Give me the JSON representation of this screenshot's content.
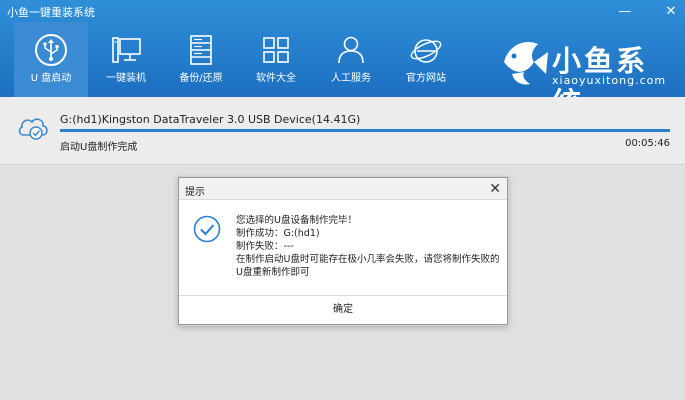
{
  "window": {
    "title": "小鱼一键重装系统",
    "minimize": "—",
    "close": "✕"
  },
  "nav": [
    {
      "id": "usb",
      "label": "U 盘启动",
      "icon": "usb-icon",
      "active": true
    },
    {
      "id": "reinstall",
      "label": "一键装机",
      "icon": "computer-icon"
    },
    {
      "id": "backup",
      "label": "备份/还原",
      "icon": "server-icon"
    },
    {
      "id": "software",
      "label": "软件大全",
      "icon": "grid-icon"
    },
    {
      "id": "service",
      "label": "人工服务",
      "icon": "person-icon"
    },
    {
      "id": "website",
      "label": "官方网站",
      "icon": "ie-icon"
    }
  ],
  "brand": {
    "name": "小鱼系统",
    "url": "xiaoyuxitong.com",
    "logo": "fish-logo-icon"
  },
  "task": {
    "device": "G:(hd1)Kingston DataTraveler 3.0 USB Device(14.41G)",
    "status": "启动U盘制作完成",
    "time": "00:05:46",
    "progress": 1.0
  },
  "dialog": {
    "title": "提示",
    "close": "✕",
    "line1": "您选择的U盘设备制作完毕！",
    "line2": "制作成功：G:(hd1)",
    "line3": "制作失败：---",
    "line4": "在制作启动U盘时可能存在极小几率会失败，请您将制作失败的",
    "line5": "U盘重新制作即可",
    "ok": "确定"
  },
  "colors": {
    "header": "#2a84d2",
    "progress": "#2980d0",
    "check": "#2a7fd0"
  }
}
